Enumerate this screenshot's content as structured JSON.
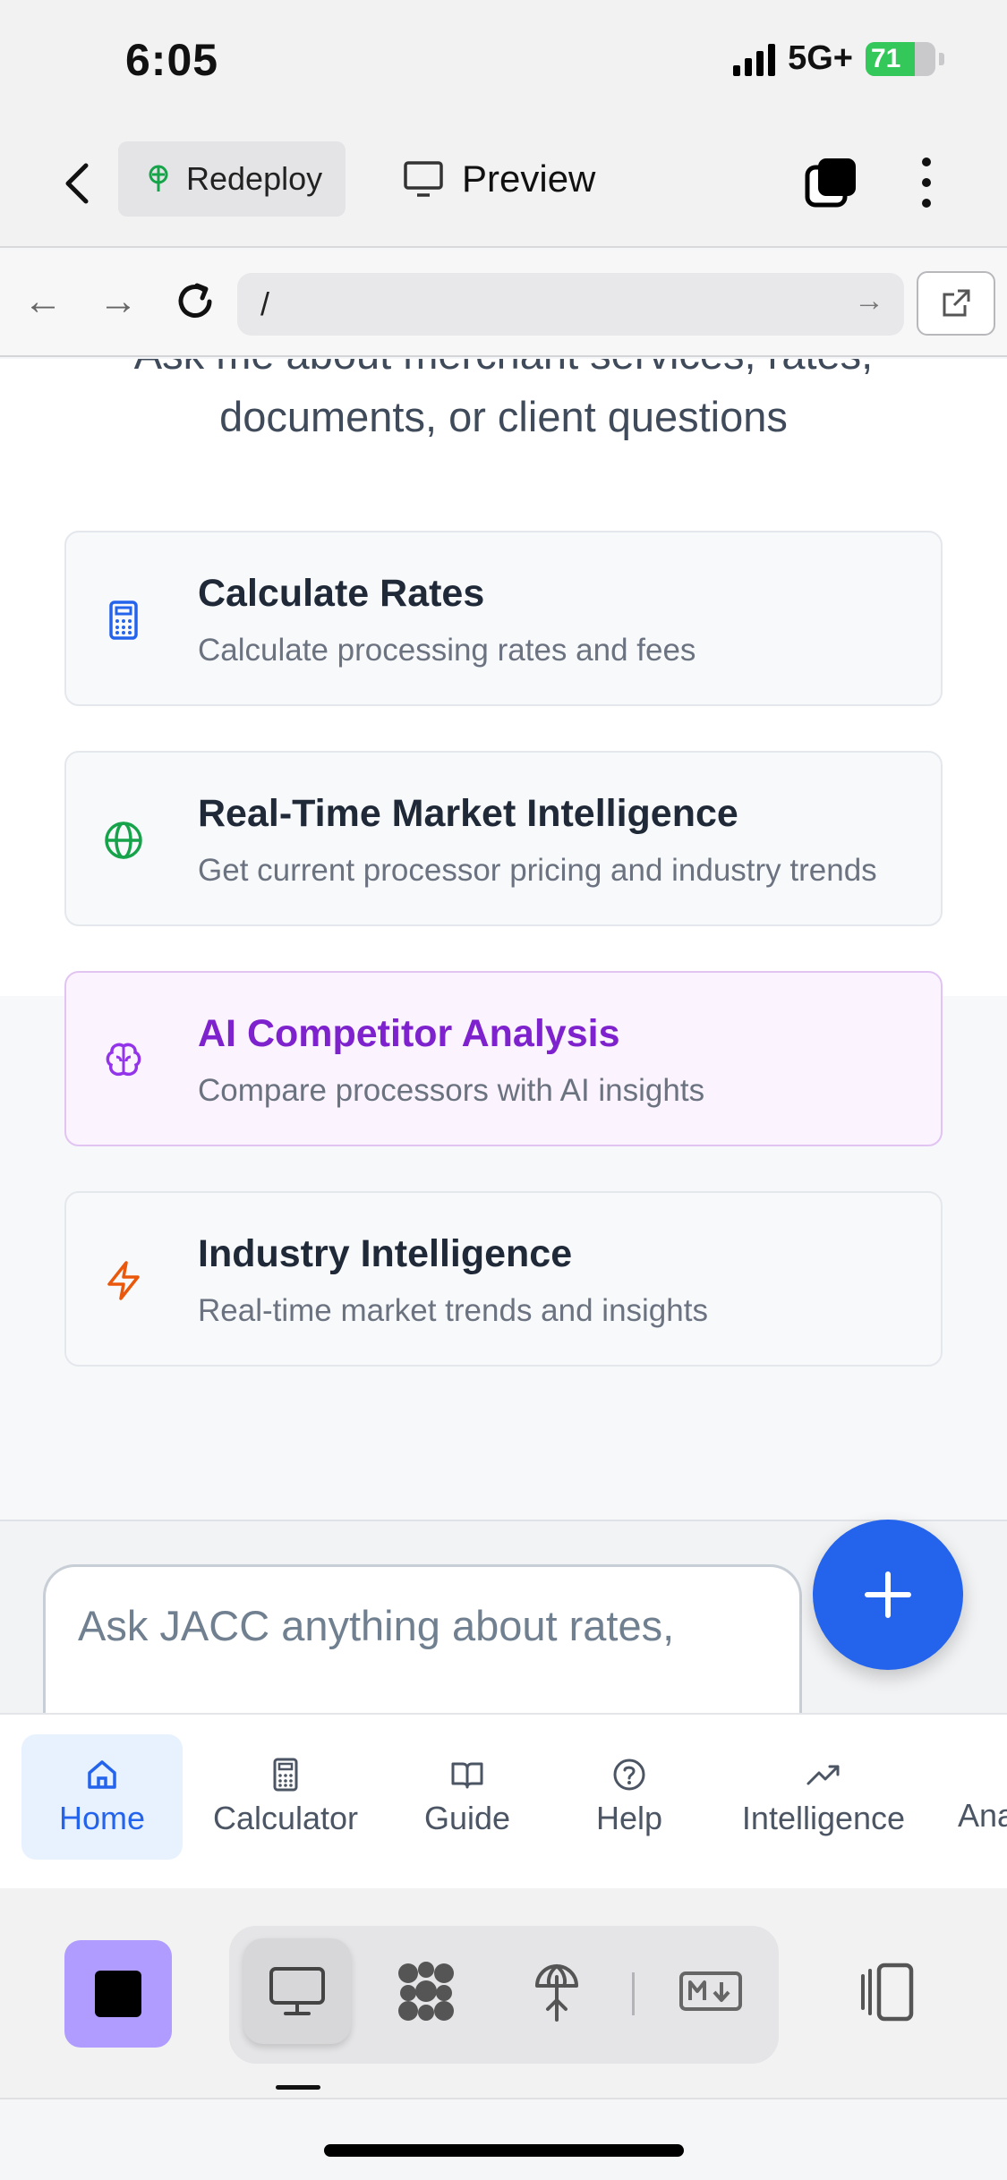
{
  "status_bar": {
    "time": "6:05",
    "network": "5G+",
    "battery": "71",
    "battery_level": 0.71
  },
  "header": {
    "back_label": "‹",
    "redeploy_label": "Redeploy",
    "preview_label": "Preview"
  },
  "browser": {
    "url": "/",
    "back_arrow": "←",
    "forward_arrow": "→",
    "go_arrow": "→"
  },
  "main": {
    "subtitle_cut": "Ask me about merchant services, rates,",
    "subtitle": "documents, or client questions",
    "cards": [
      {
        "title": "Calculate Rates",
        "description": "Calculate processing rates and fees",
        "icon": "calculator-icon",
        "color": "#2463eb"
      },
      {
        "title": "Real-Time Market Intelligence",
        "description": "Get current processor pricing and industry trends",
        "icon": "globe-icon",
        "color": "#16a34a"
      },
      {
        "title": "AI Competitor Analysis",
        "description": "Compare processors with AI insights",
        "icon": "brain-icon",
        "color": "#9333ea",
        "active": true
      },
      {
        "title": "Industry Intelligence",
        "description": "Real-time market trends and insights",
        "icon": "zap-icon",
        "color": "#ea580c"
      }
    ]
  },
  "input": {
    "placeholder": "Ask JACC anything about rates,"
  },
  "bottom_nav": {
    "items": [
      {
        "label": "Home",
        "icon": "home-icon",
        "active": true
      },
      {
        "label": "Calculator",
        "icon": "calculator-icon"
      },
      {
        "label": "Guide",
        "icon": "book-icon"
      },
      {
        "label": "Help",
        "icon": "help-circle-icon"
      },
      {
        "label": "Intelligence",
        "icon": "trending-up-icon"
      },
      {
        "label": "Ana",
        "icon": ""
      }
    ]
  },
  "colors": {
    "accent": "#2463eb",
    "purple": "#9333ea",
    "stop_button": "#b09cff"
  }
}
